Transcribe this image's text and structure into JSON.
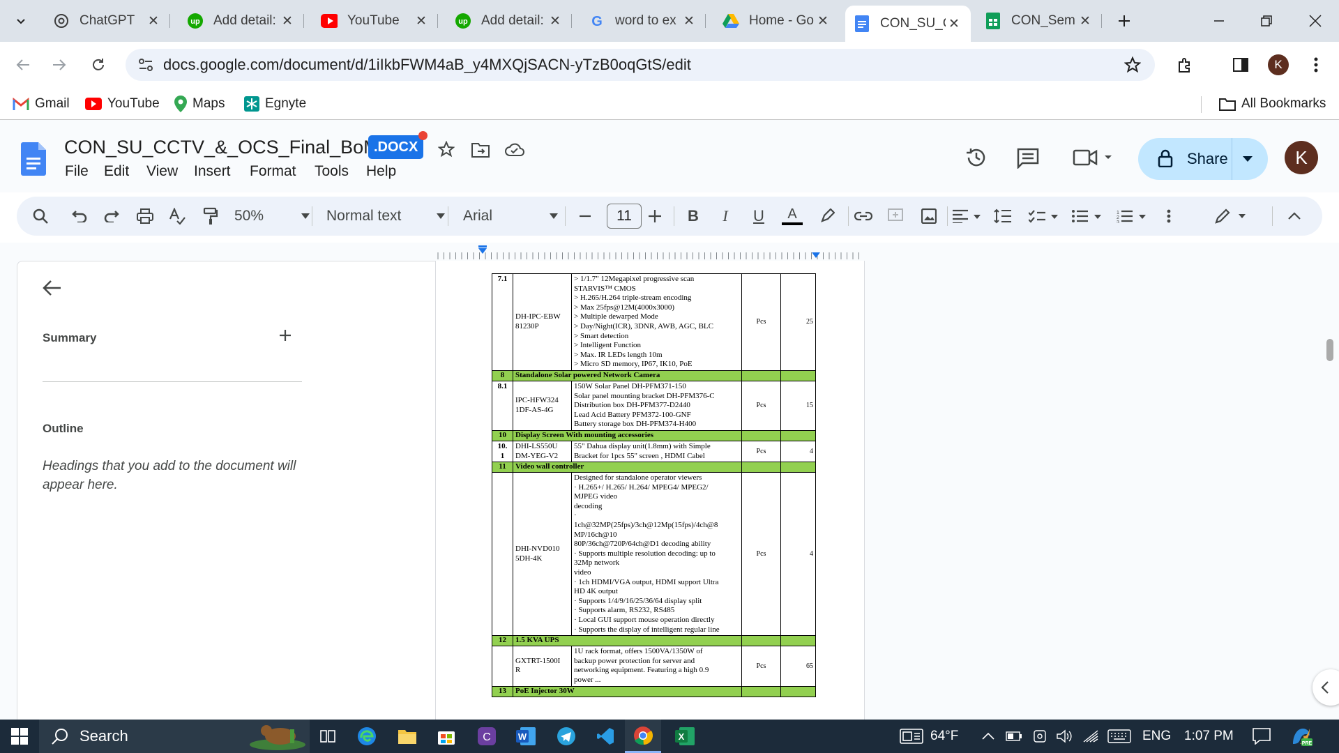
{
  "browser": {
    "tabs": [
      {
        "title": "ChatGPT",
        "icon": "chatgpt-icon"
      },
      {
        "title": "Add detail:",
        "icon": "upwork-icon"
      },
      {
        "title": "YouTube",
        "icon": "youtube-icon"
      },
      {
        "title": "Add detail:",
        "icon": "upwork-icon"
      },
      {
        "title": "word to ex",
        "icon": "google-icon"
      },
      {
        "title": "Home - Go",
        "icon": "drive-icon"
      },
      {
        "title": "CON_SU_C",
        "icon": "docs-icon",
        "active": true
      },
      {
        "title": "CON_Sem",
        "icon": "sheets-icon"
      }
    ],
    "url": "docs.google.com/document/d/1iIkbFWM4aB_y4MXQjSACN-yTzB0oqGtS/edit",
    "profile_initial": "K",
    "bookmarks": [
      {
        "label": "Gmail",
        "icon": "gmail-icon"
      },
      {
        "label": "YouTube",
        "icon": "youtube-icon"
      },
      {
        "label": "Maps",
        "icon": "maps-icon"
      },
      {
        "label": "Egnyte",
        "icon": "egnyte-icon"
      }
    ],
    "all_bookmarks": "All Bookmarks"
  },
  "doc": {
    "title": "CON_SU_CCTV_&_OCS_Final_BoM",
    "badge": ".DOCX",
    "menus": [
      "File",
      "Edit",
      "View",
      "Insert",
      "Format",
      "Tools",
      "Help"
    ],
    "share_label": "Share",
    "user_initial": "K"
  },
  "toolbar": {
    "zoom": "50%",
    "style": "Normal text",
    "font": "Arial",
    "font_size": "11"
  },
  "outline_panel": {
    "summary": "Summary",
    "outline": "Outline",
    "hint": "Headings that you add to the document will appear here."
  },
  "table": {
    "rows": [
      {
        "type": "item",
        "no": "7.1",
        "model": "DH-IPC-EBW\n81230P",
        "desc": "> 1/1.7\" 12Megapixel progressive scan\nSTARVIS™ CMOS\n> H.265/H.264 triple-stream encoding\n> Max 25fps@12M(4000x3000)\n> Multiple dewarped Mode\n> Day/Night(ICR), 3DNR, AWB, AGC, BLC\n> Smart detection\n> Intelligent Function\n> Max. IR LEDs length 10m\n> Micro SD memory, IP67, IK10, PoE",
        "unit": "Pcs",
        "qty": "25"
      },
      {
        "type": "header",
        "no": "8",
        "title": "Standalone Solar powered Network Camera"
      },
      {
        "type": "item",
        "no": "8.1",
        "model": "IPC-HFW324\n1DF-AS-4G",
        "desc": "150W Solar Panel DH-PFM371-150\nSolar panel mounting bracket DH-PFM376-C\nDistribution box DH-PFM377-D2440\nLead Acid Battery PFM372-100-GNF\nBattery storage box DH-PFM374-H400",
        "unit": "Pcs",
        "qty": "15"
      },
      {
        "type": "header",
        "no": "10",
        "title": "Display Screen With mounting accessories"
      },
      {
        "type": "item",
        "no": "10.\n1",
        "model": "DHI-LS550U\nDM-YEG-V2",
        "desc": "55\" Dahua display unit(1.8mm) with Simple\nBracket for 1pcs 55\" screen , HDMI Cabel",
        "unit": "Pcs",
        "qty": "4"
      },
      {
        "type": "header",
        "no": "11",
        "title": "Video wall controller"
      },
      {
        "type": "item",
        "no": "",
        "model": "DHI-NVD010\n5DH-4K",
        "desc": "  Designed for standalone operator viewers\n· H.265+/ H.265/ H.264/ MPEG4/ MPEG2/\nMJPEG video\ndecoding\n·\n1ch@32MP(25fps)/3ch@12Mp(15fps)/4ch@8\nMP/16ch@10\n80P/36ch@720P/64ch@D1 decoding ability\n·  Supports multiple resolution decoding: up to\n32Mp network\nvideo\n·  1ch HDMI/VGA output, HDMI support Ultra\nHD 4K output\n·  Supports 1/4/9/16/25/36/64 display split\n·  Supports alarm, RS232, RS485\n·  Local GUI support mouse operation directly\n·  Supports the display of intelligent regular line",
        "unit": "Pcs",
        "qty": "4"
      },
      {
        "type": "header",
        "no": "12",
        "title": "1.5 KVA UPS"
      },
      {
        "type": "item",
        "no": "",
        "model": "GXTRT-1500I\nR",
        "desc": "  1U rack format, offers 1500VA/1350W of\nbackup power protection for server and\nnetworking equipment. Featuring a high 0.9\npower ...",
        "unit": "Pcs",
        "qty": "65"
      },
      {
        "type": "header",
        "no": "13",
        "title": "PoE Injector 30W"
      }
    ]
  },
  "taskbar": {
    "search": "Search",
    "weather": "64°F",
    "lang": "ENG",
    "time": "1:07 PM"
  },
  "colors": {
    "tab_strip": "#dde3ea",
    "header_row_green": "#92d050",
    "share_button": "#c2e7ff",
    "taskbar": "#1c2b3a"
  }
}
